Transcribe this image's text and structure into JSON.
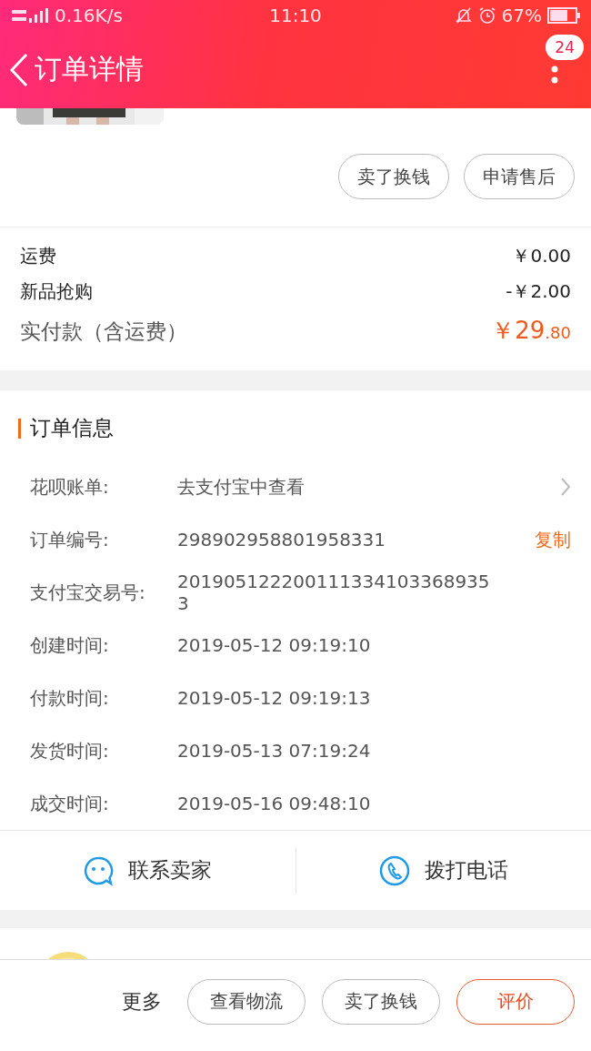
{
  "status_bar": {
    "network": "0.16K/s",
    "time": "11:10",
    "battery": "67%"
  },
  "header": {
    "title": "订单详情",
    "badge": "24"
  },
  "product_actions": [
    "卖了换钱",
    "申请售后"
  ],
  "fees": [
    {
      "label": "运费",
      "value": "￥0.00"
    },
    {
      "label": "新品抢购",
      "value": "-￥2.00"
    }
  ],
  "total": {
    "label": "实付款（含运费）",
    "amount": "￥29",
    "decimals": ".80"
  },
  "order_info": {
    "title": "订单信息",
    "rows": [
      {
        "kind": "link",
        "label": "花呗账单:",
        "value": "去支付宝中查看"
      },
      {
        "kind": "copy",
        "label": "订单编号:",
        "value": "298902958801958331",
        "action": "复制"
      },
      {
        "kind": "plain",
        "label": "支付宝交易号:",
        "value": "2019051222001113341033689353"
      },
      {
        "kind": "plain",
        "label": "创建时间:",
        "value": "2019-05-12 09:19:10"
      },
      {
        "kind": "plain",
        "label": "付款时间:",
        "value": "2019-05-12 09:19:13"
      },
      {
        "kind": "plain",
        "label": "发货时间:",
        "value": "2019-05-13 07:19:24"
      },
      {
        "kind": "plain",
        "label": "成交时间:",
        "value": "2019-05-16 09:48:10"
      }
    ]
  },
  "contact": [
    {
      "kind": "chat",
      "label": "联系卖家"
    },
    {
      "kind": "phone",
      "label": "拨打电话"
    }
  ],
  "bottom_bar": {
    "more": "更多",
    "buttons": [
      {
        "label": "查看物流",
        "primary": false
      },
      {
        "label": "卖了换钱",
        "primary": false
      },
      {
        "label": "评价",
        "primary": true
      }
    ]
  }
}
